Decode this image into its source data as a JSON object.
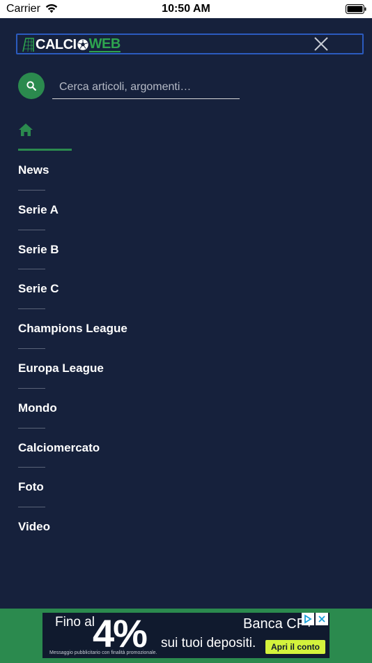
{
  "status_bar": {
    "carrier": "Carrier",
    "time": "10:50 AM",
    "wifi_icon": "wifi-icon",
    "battery_icon": "battery-icon"
  },
  "header": {
    "logo_part1": "CALCI",
    "logo_part2": "WEB",
    "close_icon": "close-icon"
  },
  "search": {
    "placeholder": "Cerca articoli, argomenti…",
    "value": "",
    "icon": "search-icon"
  },
  "home": {
    "icon": "home-icon"
  },
  "nav": {
    "items": [
      {
        "label": "News"
      },
      {
        "label": "Serie A"
      },
      {
        "label": "Serie B"
      },
      {
        "label": "Serie C"
      },
      {
        "label": "Champions League"
      },
      {
        "label": "Europa League"
      },
      {
        "label": "Mondo"
      },
      {
        "label": "Calciomercato"
      },
      {
        "label": "Foto"
      },
      {
        "label": "Video"
      }
    ]
  },
  "ad": {
    "prefix": "Fino al",
    "rate": "4%",
    "brand": "Banca CF+",
    "tagline": "sui tuoi depositi.",
    "cta": "Apri il conto",
    "disclaimer": "Messaggio pubblicitario con finalità promozionale."
  },
  "colors": {
    "background": "#16213c",
    "accent_green": "#2b8a4e",
    "logo_border": "#2b5bbf",
    "ad_cta": "#d4f23c"
  }
}
